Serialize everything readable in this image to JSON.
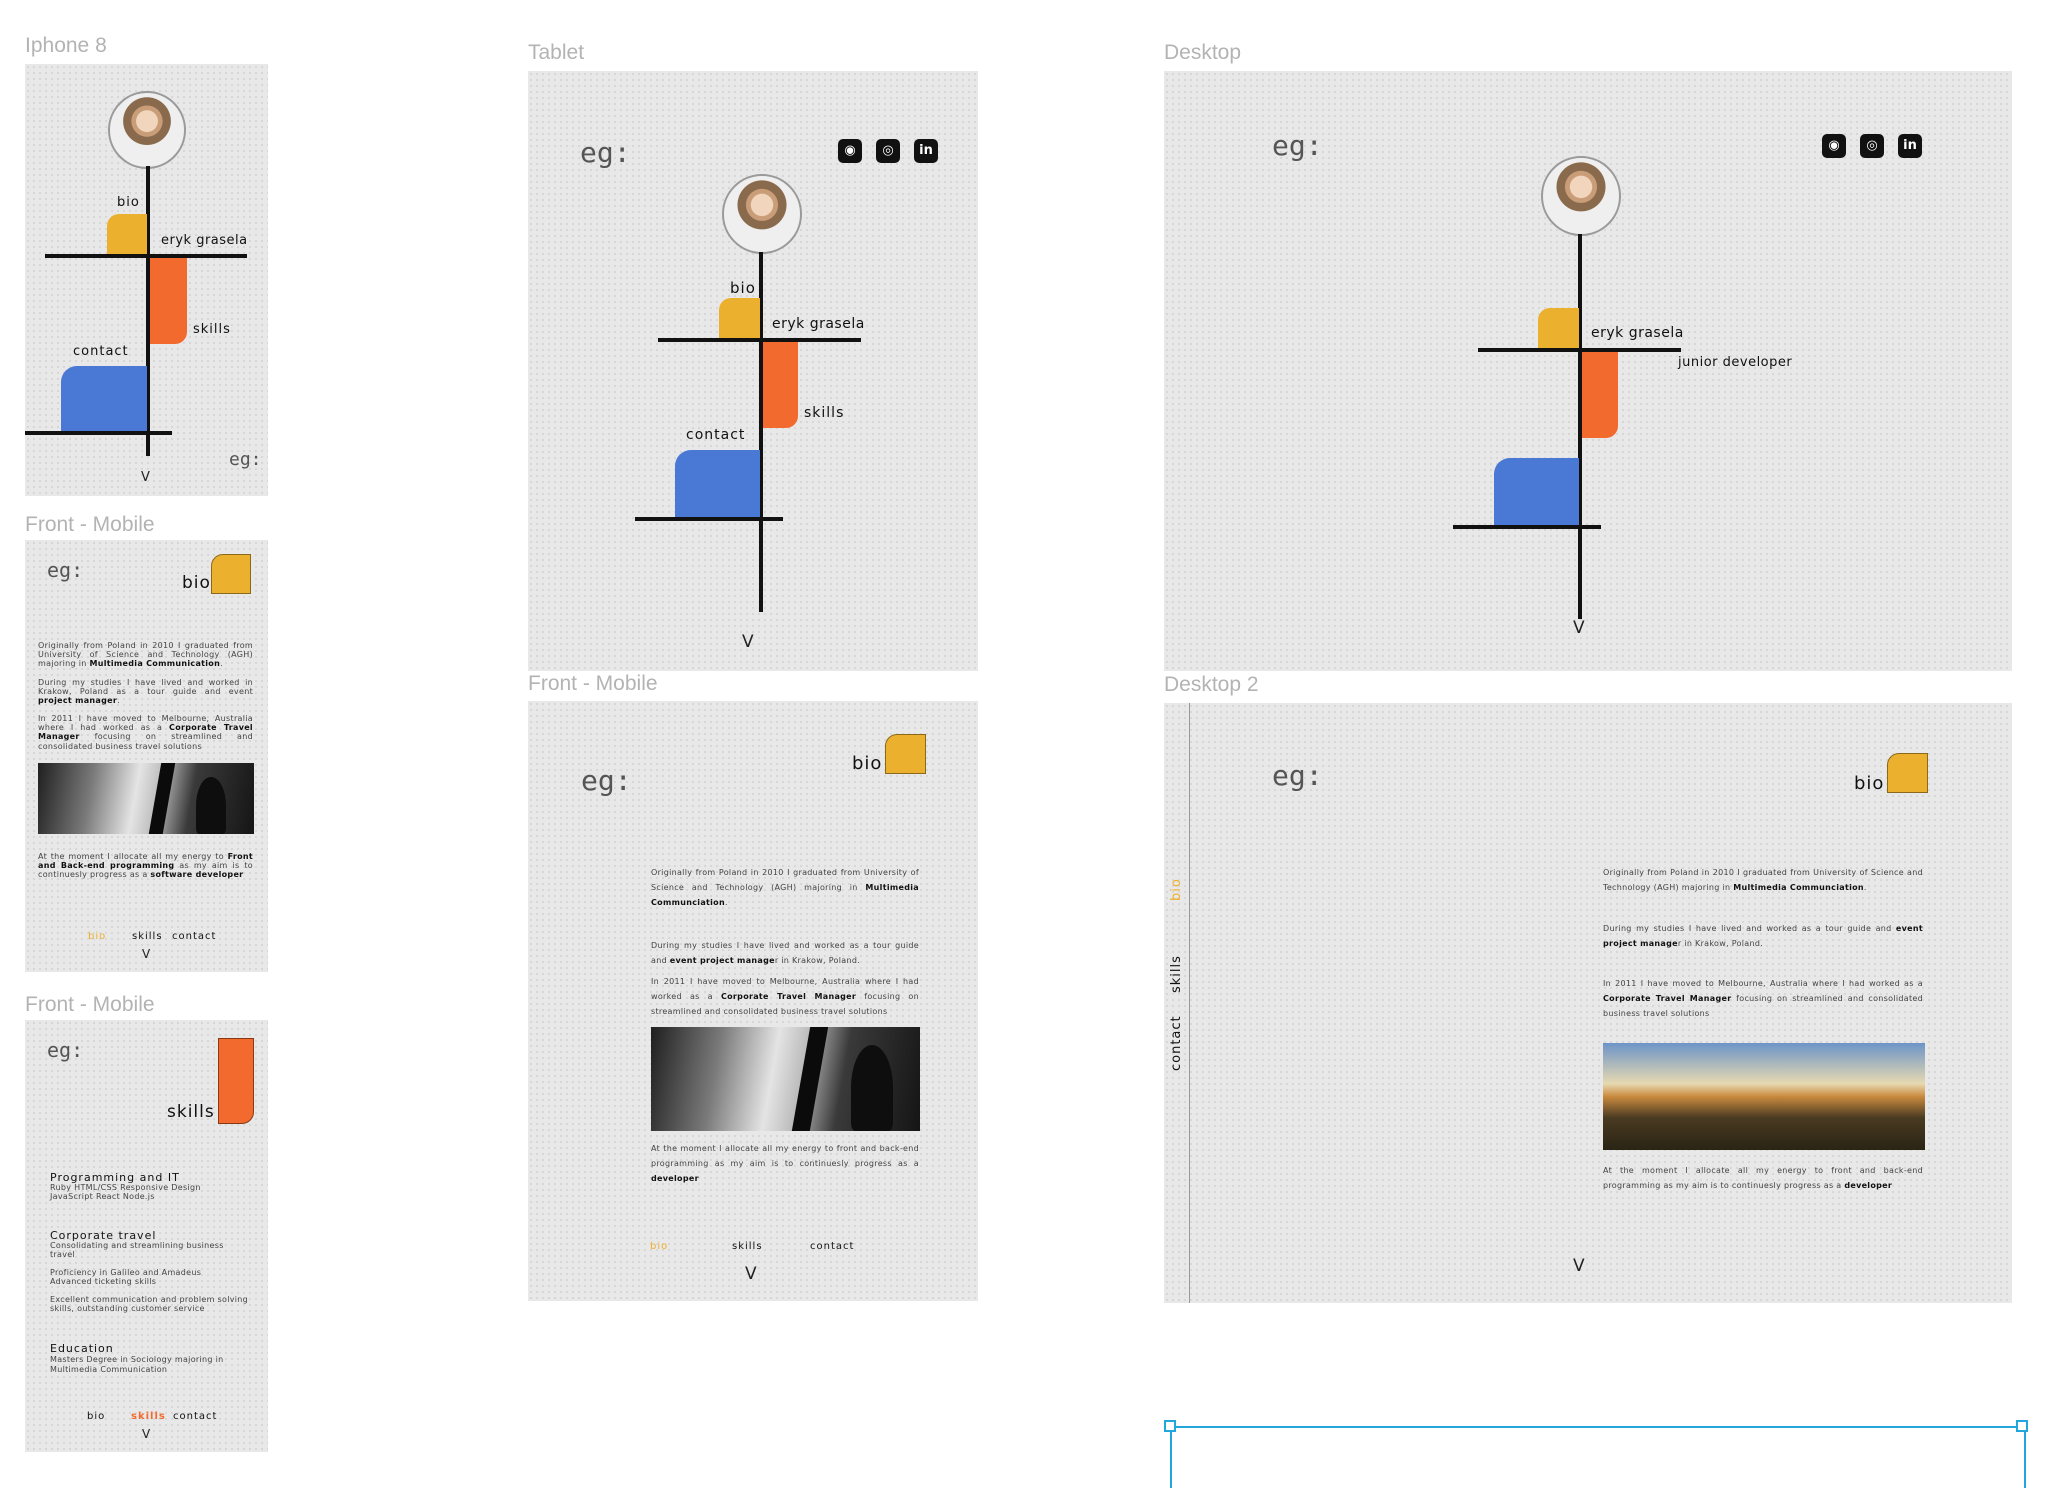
{
  "colors": {
    "yellow": "#ecb02f",
    "orange": "#f26a2e",
    "blue": "#4a79d5",
    "frame_bg": "#e8e8e8",
    "selection": "#22a6dc"
  },
  "frame_labels": {
    "iphone8": "Iphone 8",
    "front_mobile_1": "Front - Mobile",
    "front_mobile_2": "Front - Mobile",
    "tablet": "Tablet",
    "front_mobile_3": "Front - Mobile",
    "desktop": "Desktop",
    "desktop2": "Desktop 2"
  },
  "common": {
    "name": "eryk grasela",
    "role": "junior developer",
    "bio": "bio",
    "skills": "skills",
    "contact": "contact",
    "chevron": "V",
    "logo": "eg:"
  },
  "social_icons": [
    {
      "icon": "github-icon",
      "glyph": "◉"
    },
    {
      "icon": "instagram-icon",
      "glyph": "◎"
    },
    {
      "icon": "linkedin-icon",
      "glyph": "in"
    }
  ],
  "bio_short": {
    "p1": [
      "Originally from Poland in 2010 I graduated from University of Science and Technology (AGH) majoring in ",
      "Multimedia Communication",
      "."
    ],
    "p2": [
      "During my studies I have lived and worked in Krakow, Poland as a tour guide and event ",
      "project manager",
      "."
    ],
    "p3": [
      "In 2011 I have moved to Melbourne, Australia where I had worked as a ",
      "Corporate Travel Manager",
      " focusing on streamlined and consolidated business travel solutions"
    ],
    "p4": [
      "At the moment I allocate all my energy to ",
      "Front and Back-end programming",
      " as my aim is to continuesly progress as a ",
      "software developer"
    ]
  },
  "bio_tablet": {
    "p1": [
      "Originally from Poland in 2010 I graduated from University of Science and Technology (AGH)  majoring in ",
      "Multimedia Communciation",
      "."
    ],
    "p2": [
      "During my studies I have lived and worked as a tour guide and ",
      "event project manage",
      "r in Krakow, Poland."
    ],
    "p3": [
      "In 2011 I have moved to Melbourne, Australia where I had worked as a ",
      "Corporate Travel Manager",
      " focusing on streamlined and consolidated business travel solutions"
    ],
    "p4": [
      "At the moment I allocate all my energy to front and back-end programming as my aim is to continuesly progress as a ",
      "developer"
    ]
  },
  "bio_desktop": {
    "p1": [
      "Originally from Poland in 2010 I graduated from University of Science and Technology (AGH)  majoring in ",
      "Multimedia Communciation",
      "."
    ],
    "p2": [
      "During my studies I have lived and worked as a tour guide and ",
      "event project manage",
      "r in Krakow, Poland."
    ],
    "p3": [
      "In 2011 I have moved to Melbourne, Australia where I had worked as a ",
      "Corporate Travel Manager",
      " focusing on streamlined and consolidated business travel solutions"
    ],
    "p4": [
      "At the moment I allocate all my energy to front and back-end programming as my aim is to continuesly progress as a ",
      "developer"
    ]
  },
  "skills_page": {
    "sections": [
      {
        "title": "Programming and IT",
        "lines": [
          "Ruby HTML/CSS Responsive Design",
          "JavaScript React Node.js"
        ]
      },
      {
        "title": "Corporate travel",
        "lines": [
          "Consolidating and streamlining business travel",
          "Proficiency in Galileo and Amadeus Advanced ticketing skills",
          "Excellent communication and problem solving skills, outstanding customer service"
        ]
      },
      {
        "title": "Education",
        "lines": [
          "Masters Degree in Sociology majoring in Multimedia Communication"
        ]
      }
    ]
  }
}
